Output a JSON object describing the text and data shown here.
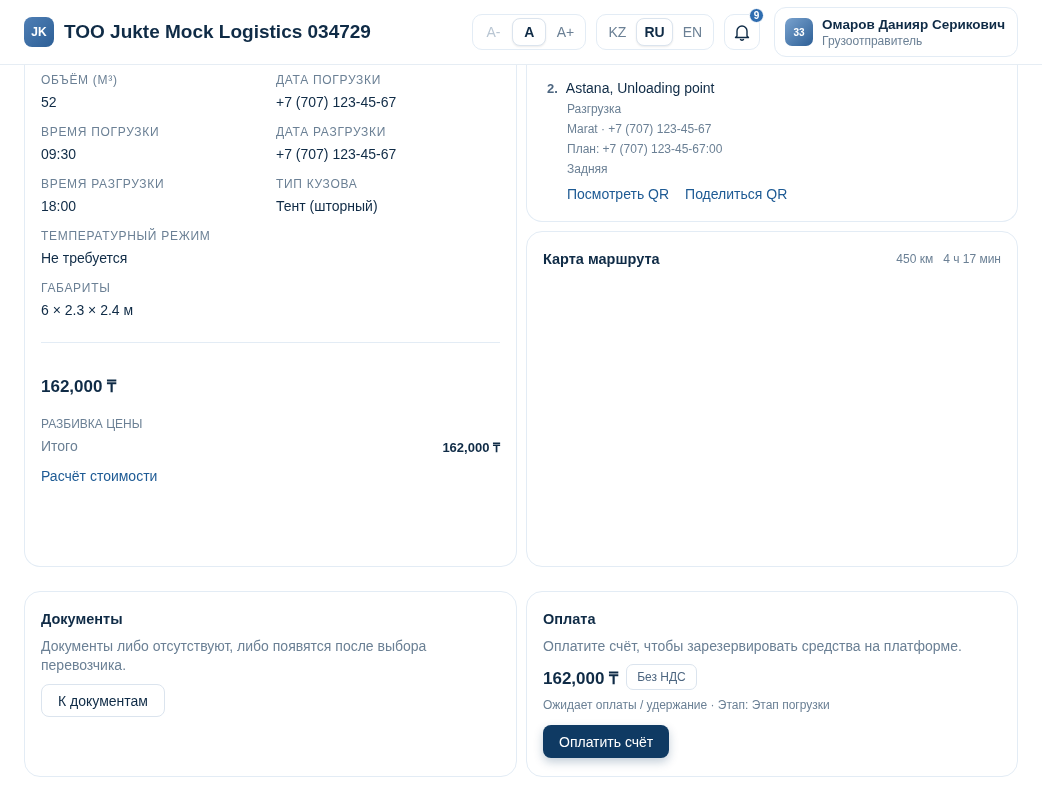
{
  "header": {
    "logo": "JK",
    "title": "TOO Jukte Mock Logistics 034729",
    "font_size": [
      {
        "label": "A-",
        "selected": false,
        "disabled": true
      },
      {
        "label": "A",
        "selected": true,
        "disabled": false
      },
      {
        "label": "A+",
        "selected": false,
        "disabled": false
      }
    ],
    "languages": [
      {
        "label": "KZ",
        "selected": false
      },
      {
        "label": "RU",
        "selected": true
      },
      {
        "label": "EN",
        "selected": false
      }
    ],
    "notifications": {
      "count": "9"
    },
    "user": {
      "avatar": "33",
      "name": "Омаров Данияр Серикович",
      "role": "Грузоотправитель"
    }
  },
  "cargo_details": {
    "left_fields": [
      {
        "label": "ОБЪЁМ (М³)",
        "value": "52"
      },
      {
        "label": "ВРЕМЯ ПОГРУЗКИ",
        "value": "09:30"
      },
      {
        "label": "ВРЕМЯ РАЗГРУЗКИ",
        "value": "18:00"
      },
      {
        "label": "ТЕМПЕРАТУРНЫЙ РЕЖИМ",
        "value": "Не требуется"
      },
      {
        "label": "ГАБАРИТЫ",
        "value": "6 × 2.3 × 2.4 м"
      }
    ],
    "right_fields": [
      {
        "label": "ДАТА ПОГРУЗКИ",
        "value": "+7 (707) 123-45-67"
      },
      {
        "label": "ДАТА РАЗГРУЗКИ",
        "value": "+7 (707) 123-45-67"
      },
      {
        "label": "ТИП КУЗОВА",
        "value": "Тент (шторный)"
      }
    ],
    "price": "162,000 ₸",
    "breakdown_label": "РАЗБИВКА ЦЕНЫ",
    "breakdown_rows": [
      {
        "label": "Итого",
        "value": "162,000 ₸"
      }
    ],
    "cost_link": "Расчёт стоимости"
  },
  "route_point": {
    "number": "2.",
    "title": "Astana, Unloading point",
    "details": [
      "Разгрузка",
      "Marat · +7 (707) 123-45-67",
      "План: +7 (707) 123-45-67:00",
      "Задняя"
    ],
    "links": [
      "Посмотреть QR",
      "Поделиться QR"
    ]
  },
  "route_map": {
    "title": "Карта маршрута",
    "distance": "450 км",
    "duration": "4 ч 17 мин"
  },
  "documents": {
    "title": "Документы",
    "text": "Документы либо отсутствуют, либо появятся после выбора перевозчика.",
    "button": "К документам"
  },
  "payment": {
    "title": "Оплата",
    "text": "Оплатите счёт, чтобы зарезервировать средства на платформе.",
    "amount": "162,000 ₸",
    "vat_badge": "Без НДС",
    "status": "Ожидает оплаты / удержание · Этап: Этап погрузки",
    "button": "Оплатить счёт"
  }
}
